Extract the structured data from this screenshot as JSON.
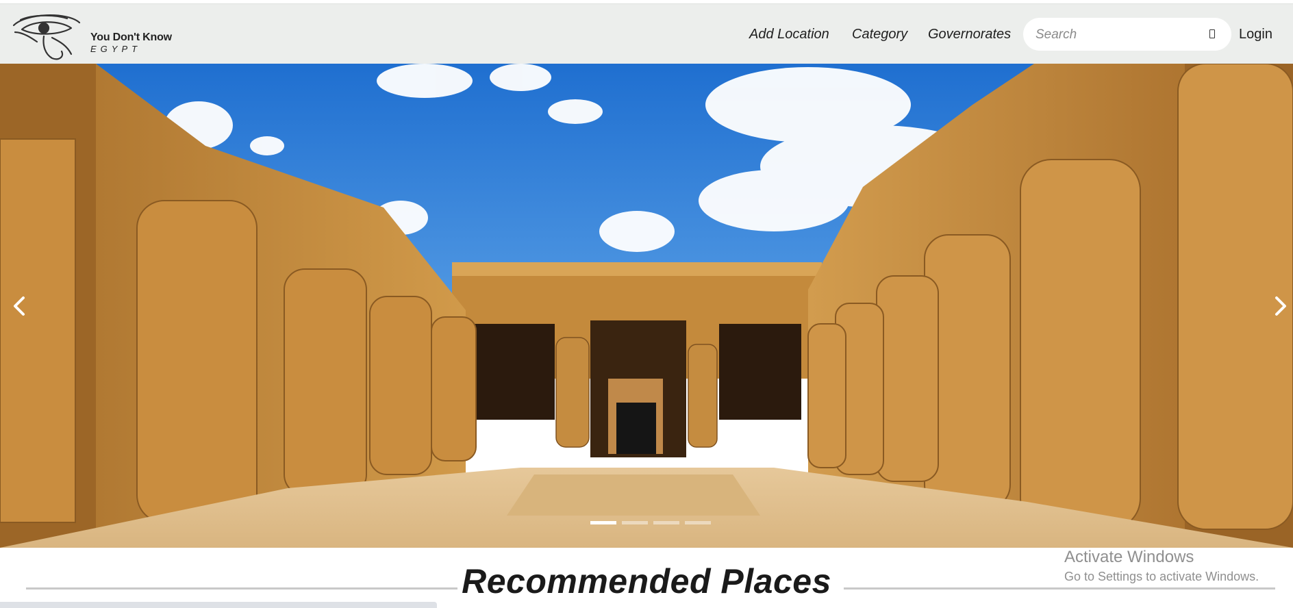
{
  "brand": {
    "title": "You Don't Know",
    "subtitle": "EGYPT",
    "logo_icon": "eye-of-horus"
  },
  "nav": {
    "items": [
      {
        "label": "Add Location"
      },
      {
        "label": "Category"
      },
      {
        "label": "Governorates"
      }
    ],
    "search": {
      "placeholder": "Search",
      "value": ""
    },
    "login": "Login"
  },
  "hero": {
    "slides_count": 4,
    "active_slide": 1,
    "prev_icon": "chevron-left-icon",
    "next_icon": "chevron-right-icon"
  },
  "section": {
    "title": "Recommended Places"
  },
  "os_watermark": {
    "line1": "Activate Windows",
    "line2": "Go to Settings to activate Windows."
  },
  "colors": {
    "navbar_bg": "#eceeec",
    "sand": "#c8913f",
    "sky": "#2f7fd6"
  }
}
